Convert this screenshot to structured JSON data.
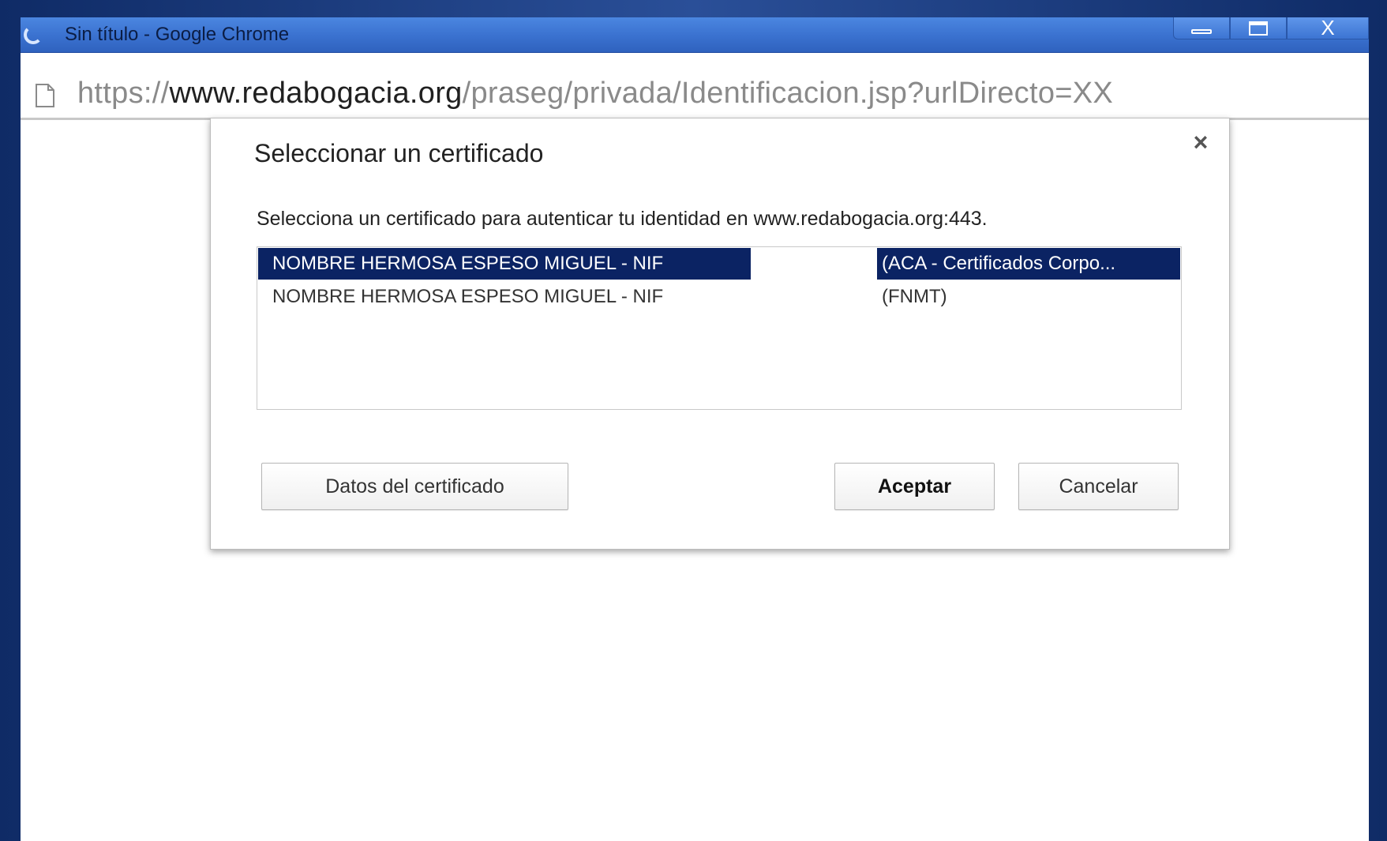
{
  "window": {
    "title": "Sin título - Google Chrome",
    "controls": {
      "minimize": "minimize",
      "maximize": "maximize",
      "close": "X"
    }
  },
  "address_bar": {
    "scheme": "https://",
    "domain": "www.redabogacia.org",
    "path": "/praseg/privada/Identificacion.jsp?urlDirecto=XX"
  },
  "dialog": {
    "title": "Seleccionar un certificado",
    "close_label": "×",
    "message": "Selecciona un certificado para autenticar tu identidad en www.redabogacia.org:443.",
    "certificates": [
      {
        "name": "NOMBRE HERMOSA ESPESO MIGUEL - NIF",
        "issuer": "(ACA - Certificados Corpo...",
        "selected": true
      },
      {
        "name": "NOMBRE HERMOSA ESPESO MIGUEL - NIF",
        "issuer": "(FNMT)",
        "selected": false
      }
    ],
    "buttons": {
      "details": "Datos del certificado",
      "accept": "Aceptar",
      "cancel": "Cancelar"
    }
  },
  "colors": {
    "titlebar": "#3a71cf",
    "selection": "#0b2363",
    "frame": "#1b3a78"
  }
}
